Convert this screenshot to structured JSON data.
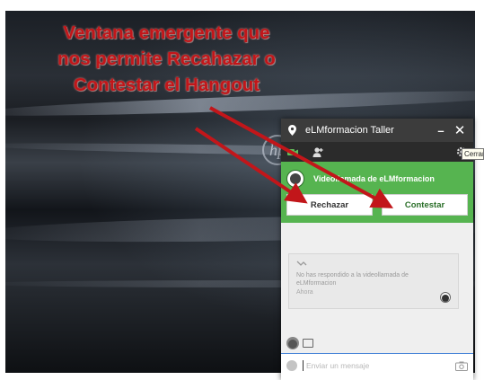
{
  "annotation": {
    "line1": "Ventana emergente que",
    "line2": "nos permite Recahazar o",
    "line3": "Contestar el Hangout",
    "color": "#c2161a"
  },
  "desktop": {
    "logo": "hp"
  },
  "hangout": {
    "title": "eLMformacion Taller",
    "minimize_label": "–",
    "close_label": "✕",
    "tooltip": "Cerrar",
    "toolbar_icons": [
      "video-camera-icon",
      "add-person-icon",
      "settings-icon"
    ],
    "call": {
      "title": "Videollamada de eLMformacion",
      "reject_label": "Rechazar",
      "answer_label": "Contestar",
      "accent": "#56b450"
    },
    "missed": {
      "text": "No has respondido a la videollamada de eLMformacion",
      "time": "Ahora"
    },
    "input": {
      "placeholder": "Enviar un mensaje"
    }
  }
}
